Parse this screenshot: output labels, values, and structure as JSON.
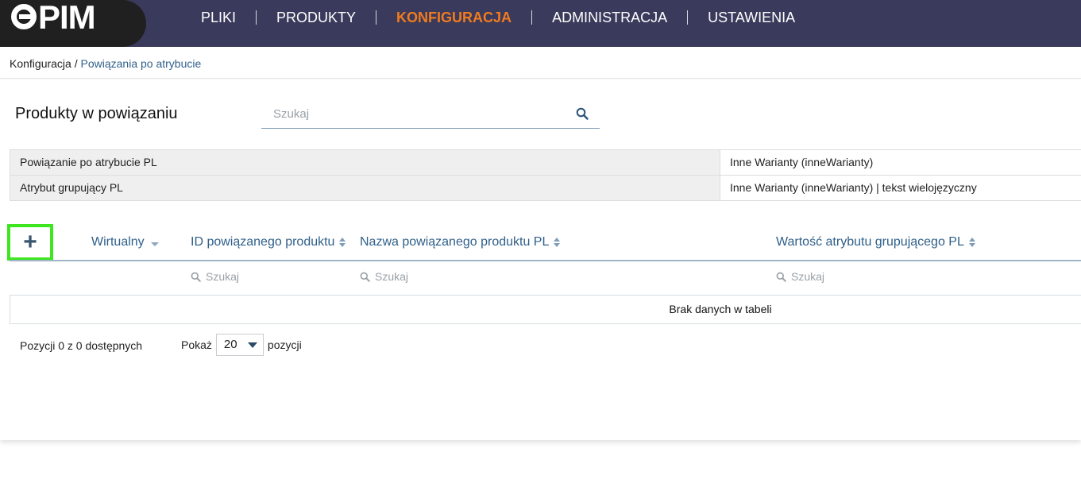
{
  "brand": {
    "logo_text": "PIM"
  },
  "nav": {
    "items": [
      {
        "label": "PLIKI",
        "active": false
      },
      {
        "label": "PRODUKTY",
        "active": false
      },
      {
        "label": "KONFIGURACJA",
        "active": true
      },
      {
        "label": "ADMINISTRACJA",
        "active": false
      },
      {
        "label": "USTAWIENIA",
        "active": false
      }
    ]
  },
  "breadcrumb": {
    "parent": "Konfiguracja",
    "separator": " / ",
    "current": "Powiązania po atrybucie"
  },
  "section": {
    "title": "Produkty w powiązaniu"
  },
  "search": {
    "placeholder": "Szukaj",
    "value": ""
  },
  "info": {
    "rows": [
      {
        "key": "Powiązanie po atrybucie PL",
        "value": "Inne Warianty (inneWarianty)"
      },
      {
        "key": "Atrybut grupujący PL",
        "value": "Inne Warianty (inneWarianty) | tekst wielojęzyczny"
      }
    ]
  },
  "table": {
    "add_label": "+",
    "columns": [
      {
        "label": "Wirtualny"
      },
      {
        "label": "ID powiązanego produktu"
      },
      {
        "label": "Nazwa powiązanego produktu PL"
      },
      {
        "label": "Wartość atrybutu grupującego PL"
      }
    ],
    "filters": {
      "placeholder": "Szukaj"
    },
    "empty_text": "Brak danych w tabeli"
  },
  "footer": {
    "info": "Pozycji 0 z 0 dostępnych",
    "show_label": "Pokaż",
    "page_size": "20",
    "suffix_label": "pozycji"
  },
  "colors": {
    "topbar": "#3a3a5c",
    "active_nav": "#f07b1e",
    "link": "#2f5f8a",
    "add_highlight": "#3ee61f"
  }
}
